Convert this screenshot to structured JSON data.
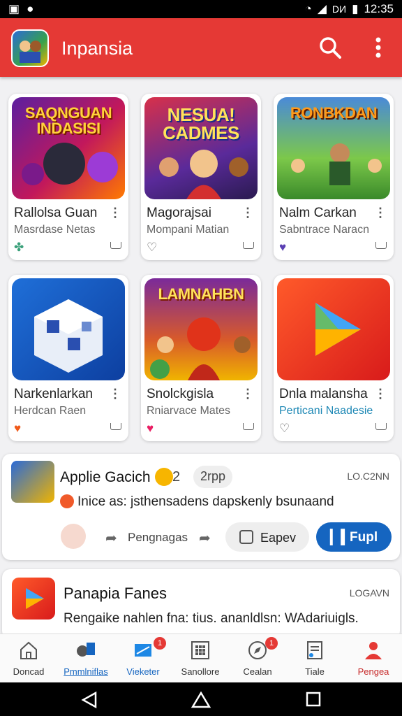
{
  "status_bar": {
    "time": "12:35",
    "carrier": "DИ"
  },
  "app_bar": {
    "title": "Inpansia",
    "accent": "#e53935"
  },
  "tiles": [
    {
      "art_text": "SAQNGUAN INDASISI",
      "title": "Rallolsa Guan",
      "subtitle": "Masrdase Netas",
      "heart_color": "#3aa07a"
    },
    {
      "art_text": "NESUA! CADMES",
      "title": "Magorajsai",
      "subtitle": "Mompani Matian",
      "heart_color": "#666666"
    },
    {
      "art_text": "RONBKDAN",
      "title": "Nalm Carkan",
      "subtitle": "Sabntrace Naracn",
      "heart_color": "#5a3fb3"
    },
    {
      "art_text": "",
      "title": "Narkenlarkan",
      "subtitle": "Herdcan Raen",
      "heart_color": "#f05a1a"
    },
    {
      "art_text": "LAMNAHBN",
      "title": "Snolckgisla",
      "subtitle": "Rniarvace Mates",
      "heart_color": "#e91e63"
    },
    {
      "art_text": "",
      "title": "Dnla malansha",
      "subtitle": "Perticani Naadesie",
      "heart_color": "#666666"
    }
  ],
  "feed1": {
    "author": "Applie Gacich",
    "count": "2",
    "tag": "2rpp",
    "tag_right": "LO.C2NN",
    "message": "Inice as: jsthensadens dapskenly bsunaand",
    "action_share": "Pengnagas",
    "action_secondary": "Eapev",
    "action_primary": "Fupl"
  },
  "feed2": {
    "title": "Panapia Fanes",
    "tag_right": "LOGAVN",
    "message": "Rengaike nahlen fna: tius. ananldlsn: WAdariuigls."
  },
  "bottom_nav": [
    {
      "label": "Doncad",
      "icon": "home-icon"
    },
    {
      "label": "Pmmlniflas",
      "icon": "profile-chart-icon"
    },
    {
      "label": "Vieketer",
      "icon": "window-icon",
      "badge": "1"
    },
    {
      "label": "Sanollore",
      "icon": "grid-icon"
    },
    {
      "label": "Cealan",
      "icon": "compass-icon",
      "badge": "1"
    },
    {
      "label": "Tiale",
      "icon": "clipboard-icon"
    },
    {
      "label": "Pengea",
      "icon": "person-icon"
    }
  ]
}
